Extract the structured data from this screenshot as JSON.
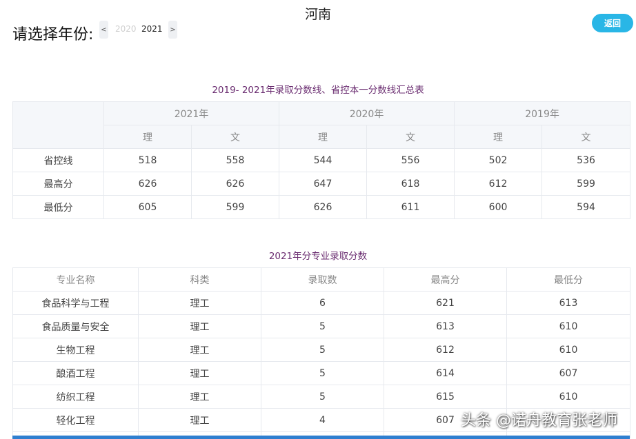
{
  "header": {
    "province": "河南",
    "year_label": "请选择年份:",
    "prev_symbol": "<",
    "next_symbol": ">",
    "years": [
      "2020",
      "2021"
    ],
    "back_label": "返回"
  },
  "summary_table": {
    "caption": "2019- 2021年录取分数线、省控本一分数线汇总表",
    "years": [
      "2021年",
      "2020年",
      "2019年"
    ],
    "subjects": [
      "理",
      "文",
      "理",
      "文",
      "理",
      "文"
    ],
    "rows": [
      {
        "label": "省控线",
        "values": [
          "518",
          "558",
          "544",
          "556",
          "502",
          "536"
        ]
      },
      {
        "label": "最高分",
        "values": [
          "626",
          "626",
          "647",
          "618",
          "612",
          "599"
        ]
      },
      {
        "label": "最低分",
        "values": [
          "605",
          "599",
          "626",
          "611",
          "600",
          "594"
        ]
      }
    ]
  },
  "major_table": {
    "caption": "2021年分专业录取分数",
    "headers": [
      "专业名称",
      "科类",
      "录取数",
      "最高分",
      "最低分"
    ],
    "rows": [
      [
        "食品科学与工程",
        "理工",
        "6",
        "621",
        "613"
      ],
      [
        "食品质量与安全",
        "理工",
        "5",
        "613",
        "610"
      ],
      [
        "生物工程",
        "理工",
        "5",
        "612",
        "610"
      ],
      [
        "酿酒工程",
        "理工",
        "5",
        "614",
        "607"
      ],
      [
        "纺织工程",
        "理工",
        "5",
        "615",
        "610"
      ],
      [
        "轻化工程",
        "理工",
        "4",
        "607",
        ""
      ]
    ]
  },
  "watermark": "头条 @诺舟教育张老师",
  "colors": {
    "accent": "#29b6e6",
    "caption": "#6a2c70",
    "header_bg": "#f5f7fa",
    "border": "#e6e9ee"
  }
}
